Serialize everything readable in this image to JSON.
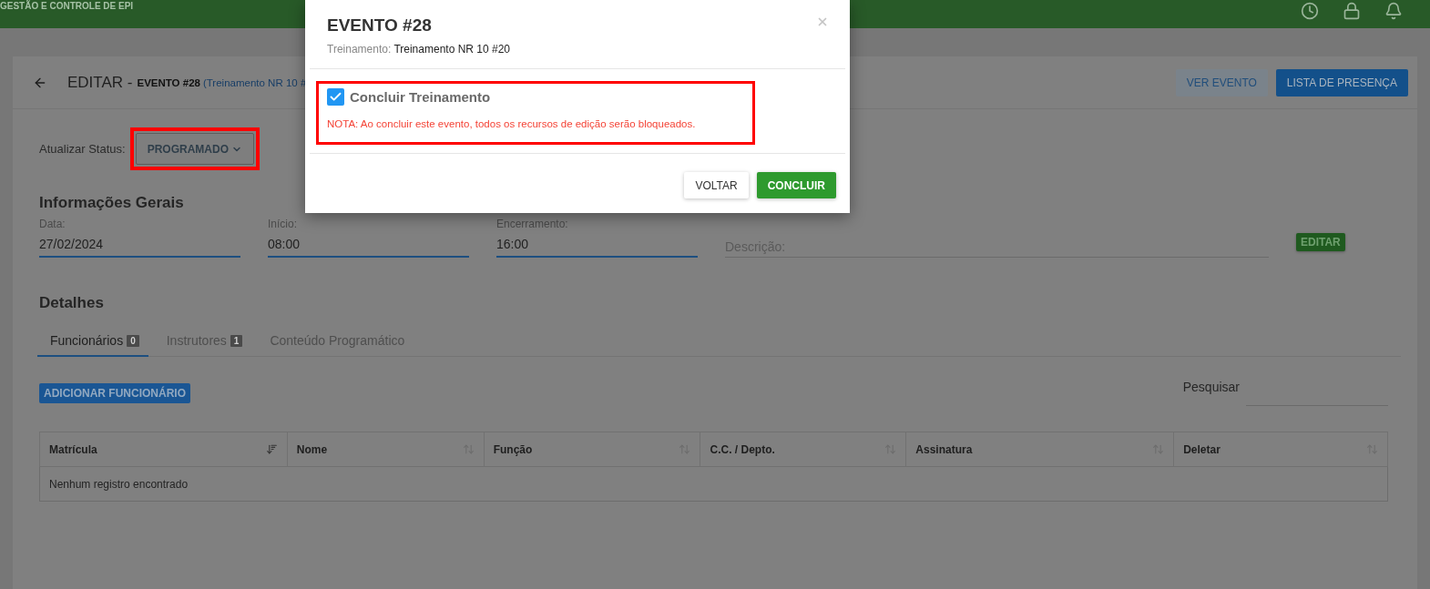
{
  "app_bar": {
    "title": "GESTÃO E CONTROLE DE EPI"
  },
  "page": {
    "title": "EDITAR -",
    "event": "EVENTO #28",
    "training": "(Treinamento NR 10 #"
  },
  "header_buttons": [
    {
      "label": "VER EVENTO",
      "kind": "light"
    },
    {
      "label": "LISTA DE PRESENÇA",
      "kind": "primary"
    }
  ],
  "status": {
    "label": "Atualizar Status:",
    "value": "PROGRAMADO",
    "highlighted": true
  },
  "general": {
    "title": "Informações Gerais",
    "fields": [
      {
        "label": "Data:",
        "value": "27/02/2024"
      },
      {
        "label": "Início:",
        "value": "08:00"
      },
      {
        "label": "Encerramento:",
        "value": "16:00"
      }
    ],
    "description": {
      "placeholder": "Descrição:"
    },
    "edit_button": "EDITAR"
  },
  "details": {
    "title": "Detalhes",
    "tabs": [
      {
        "label": "Funcionários",
        "count": "0",
        "selected": true
      },
      {
        "label": "Instrutores",
        "count": "1",
        "selected": false
      },
      {
        "label": "Conteúdo Programático",
        "selected": false
      }
    ]
  },
  "add_button": "ADICIONAR FUNCIONÁRIO",
  "search": {
    "label": "Pesquisar"
  },
  "table": {
    "columns": [
      {
        "label": "Matrícula",
        "sorted": true
      },
      {
        "label": "Nome",
        "sorted": false
      },
      {
        "label": "Função",
        "sorted": false
      },
      {
        "label": "C.C. / Depto.",
        "sorted": false
      },
      {
        "label": "Assinatura",
        "sorted": false
      },
      {
        "label": "Deletar",
        "sorted": false
      }
    ],
    "empty": "Nenhum registro encontrado"
  },
  "modal": {
    "title": "EVENTO #28",
    "subtitle_label": "Treinamento:",
    "subtitle_value": "Treinamento NR 10 #20",
    "checkbox": {
      "label": "Concluir Treinamento",
      "checked": true
    },
    "note": "NOTA: Ao concluir este evento, todos os recursos de edição serão bloqueados.",
    "highlighted": true,
    "buttons": [
      {
        "label": "VOLTAR",
        "kind": "default"
      },
      {
        "label": "CONCLUIR",
        "kind": "success"
      }
    ]
  }
}
